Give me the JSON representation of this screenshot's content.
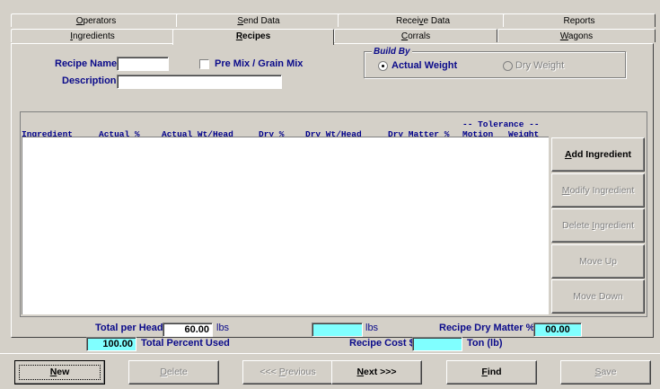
{
  "tabs_row1": [
    {
      "label": "Operators",
      "ul": "O",
      "rest": "perators"
    },
    {
      "label": "Send Data",
      "ul": "S",
      "rest": "end Data"
    },
    {
      "label": "Receive Data",
      "pre": "Recei",
      "ul": "v",
      "post": "e Data"
    },
    {
      "label": "Reports"
    }
  ],
  "tabs_row2": [
    {
      "label": "Ingredients",
      "ul": "I",
      "rest": "ngredients"
    },
    {
      "label": "Recipes",
      "ul": "R",
      "rest": "ecipes"
    },
    {
      "label": "Corrals",
      "ul": "C",
      "rest": "orrals"
    },
    {
      "label": "Wagons",
      "ul": "W",
      "rest": "agons"
    }
  ],
  "form": {
    "recipe_name_label": "Recipe Name",
    "recipe_name_value": "",
    "description_label": "Description",
    "description_value": "",
    "premix_label": "Pre Mix / Grain Mix",
    "build_by_label": "Build By",
    "actual_weight_label": "Actual Weight",
    "dry_weight_label": "Dry Weight"
  },
  "grid": {
    "tolerance_header": "-- Tolerance --",
    "columns": [
      "Ingredient",
      "Actual %",
      "Actual Wt/Head",
      "Dry %",
      "Dry Wt/Head",
      "Dry Matter %",
      "Motion",
      "Weight"
    ],
    "rows": []
  },
  "side_buttons": [
    {
      "label": "Add Ingredient",
      "enabled": true
    },
    {
      "label": "Modify Ingredient",
      "enabled": false
    },
    {
      "label": "Delete Ingredient",
      "enabled": false
    },
    {
      "label": "Move Up",
      "enabled": false
    },
    {
      "label": "Move Down",
      "enabled": false
    }
  ],
  "totals": {
    "total_per_head_label": "Total per Head",
    "total_per_head_value": "60.00",
    "lbs_unit": "lbs",
    "dry_lbs_value": "",
    "recipe_dry_matter_label": "Recipe Dry Matter %",
    "recipe_dry_matter_value": "00.00",
    "total_percent_value": "100.00",
    "total_percent_label": "Total Percent Used",
    "recipe_cost_label": "Recipe Cost $",
    "recipe_cost_value": "",
    "ton_unit": "Ton (lb)"
  },
  "bottom_buttons": [
    {
      "label": "New",
      "enabled": true,
      "focus": true
    },
    {
      "label": "Delete",
      "enabled": false
    },
    {
      "label": "<<< Previous",
      "enabled": false
    },
    {
      "label": "Next >>>",
      "enabled": true
    },
    {
      "label": "Find",
      "enabled": true
    },
    {
      "label": "Save",
      "enabled": false
    }
  ],
  "colors": {
    "label_blue": "#0a0a8a",
    "grid_header_blue": "#00008b",
    "highlight_cyan": "#80ffff"
  }
}
